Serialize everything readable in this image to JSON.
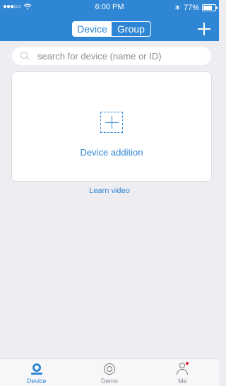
{
  "status_bar": {
    "signal_dots": "●●●○○",
    "wifi_icon": "wifi-icon",
    "time": "6:00 PM",
    "bluetooth": "∗",
    "battery_percent": "77%",
    "battery_level": 0.77
  },
  "header": {
    "tabs": [
      "Device",
      "Group"
    ],
    "active_tab": "Device",
    "add_icon": "plus-icon"
  },
  "search": {
    "placeholder": "search for device (name or ID)",
    "value": ""
  },
  "device_card": {
    "label": "Device addition",
    "icon": "add-device-icon"
  },
  "learn_link": "Learn video",
  "tab_bar": {
    "items": [
      {
        "label": "Device",
        "icon": "device-camera-icon",
        "active": true
      },
      {
        "label": "Demo",
        "icon": "demo-icon",
        "active": false
      },
      {
        "label": "Me",
        "icon": "profile-icon",
        "active": false
      }
    ]
  },
  "colors": {
    "accent": "#2f86d4",
    "background": "#ededf2",
    "badge": "#e23"
  }
}
